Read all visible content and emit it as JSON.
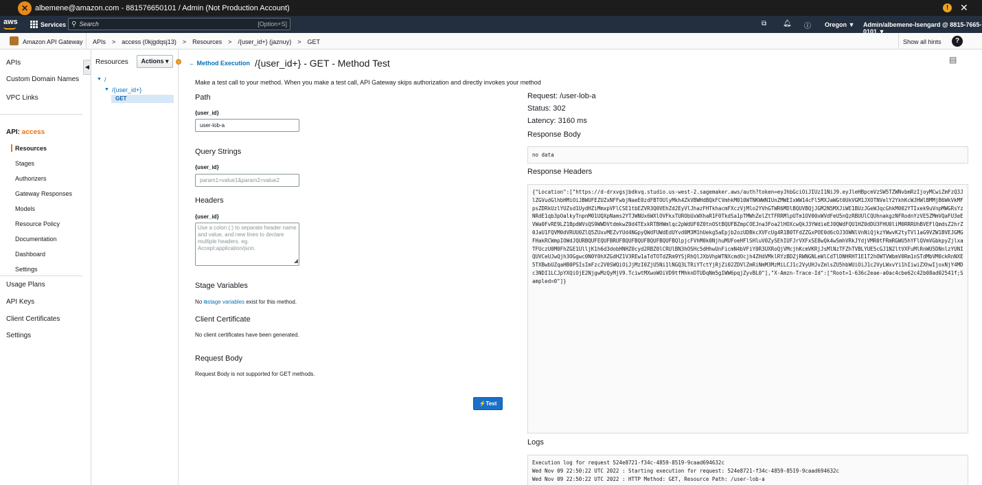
{
  "account_bar": {
    "text": "albemene@amazon.com - 881576650101 / Admin (Not Production Account)",
    "logo_icon": "account-logo",
    "warn_icon": "!",
    "close_icon": "✕"
  },
  "aws_nav": {
    "logo": "aws",
    "services_label": "Services",
    "search_placeholder": "Search",
    "search_shortcut": "[Option+S]",
    "region": "Oregon ▼",
    "user": "Admin/albemene-Isengard @ 8815-7665-0101 ▼"
  },
  "service_bar": {
    "service_name": "Amazon API Gateway",
    "breadcrumbs": [
      "APIs",
      ">",
      "access (0kjgdqsj13)",
      ">",
      "Resources",
      ">",
      "/{user_id+} (jaznuy)",
      ">",
      "GET"
    ],
    "show_hints": "Show all hints",
    "help": "?"
  },
  "left_nav": {
    "apis": "APIs",
    "custom_domains": "Custom Domain Names",
    "vpc_links": "VPC Links",
    "api_prefix": "API:",
    "api_name": "access",
    "sub_items": [
      "Resources",
      "Stages",
      "Authorizers",
      "Gateway Responses",
      "Models",
      "Resource Policy",
      "Documentation",
      "Dashboard",
      "Settings"
    ],
    "usage_plans": "Usage Plans",
    "api_keys": "API Keys",
    "client_certs": "Client Certificates",
    "settings": "Settings",
    "collapse": "◀"
  },
  "resources": {
    "title": "Resources",
    "actions": "Actions ▾",
    "root": "/",
    "child": "/{user_id+}",
    "method": "GET"
  },
  "main": {
    "back_link": "Method Execution",
    "title": "/{user_id+} - GET - Method Test",
    "intro": "Make a test call to your method. When you make a test call, API Gateway skips authorization and directly invokes your method",
    "path_heading": "Path",
    "path_label": "{user_id}",
    "path_value": "user-lob-a",
    "query_heading": "Query Strings",
    "query_label": "{user_id}",
    "query_placeholder": "param1=value1&param2=value2",
    "headers_heading": "Headers",
    "headers_label": "{user_id}",
    "headers_placeholder": "Use a colon (:) to separate header name and value, and new lines to declare multiple headers. eg. Accept:application/json.",
    "stage_vars_heading": "Stage Variables",
    "stage_vars_pre": "No",
    "stage_vars_link": "stage variables",
    "stage_vars_post": "exist for this method.",
    "client_cert_heading": "Client Certificate",
    "client_cert_text": "No client certificates have been generated.",
    "request_body_heading": "Request Body",
    "request_body_text": "Request Body is not supported for GET methods.",
    "test_button": "Test"
  },
  "response": {
    "request": "Request: /user-lob-a",
    "status": "Status: 302",
    "latency": "Latency: 3160 ms",
    "body_heading": "Response Body",
    "body": "no data",
    "headers_heading": "Response Headers",
    "headers": "{\"Location\":[\"https://d-drxvgsjbdkvq.studio.us-west-2.sagemaker.aws/auth?token=eyJhbGciOiJIUzI1NiJ9.eyJleHBpcmVzSW5TZWNvbmRzIjoyMCwiZmFzQ3JlZGVudGlhbHMiOiJBWUFEZUZxNFFwbjNaeE0zdFBTOUlyMkh4ZkVBWHdBQkFCVmhkM010WTNKWWNIUnZMWEIxWW14cFl5MXJaWGt0UkVGM1JXOTNVelY2YkhKcWJHWlBMMjB6WkVkMFpsZDRkUzlYUZsd1UydHZiMmxpVFlCSE1tbEZVR3Q0VEhZd2EyVlJhazFHTkhacmFXczVjMlo2YVhGTWR6MDlBQUVBQjJGM2N5MXJiWE1BUzJGeWJqcGhkM002YTIxek9uVnpMWGRsYzNRdE1qb3pOalkyTnpnM01UQXpNams2YTJWNUx6WXlOVFkxTURObUxWXhaR1F0TkdSa1pTMWhZelZtTFRRMlpUTm1OV00xWVdFeU5nQzRBUUlCQUhnakgzNFRodnYzVE5ZMmVQaFU3eEVWa0FvRE9LZ1BpdWVsQS9WWDVtdmkwZ0d4TExkRTBHWmlqc2pWdUF0Z0tnOStBQUFBZmpCOEJna3Foa2lHOXcwQkJ3YWdieEJ0QWdFQU1HZ0dDU3FHU0liM0RRRUhBVEFlQmdsZ2hrZ0JaU1FQVM0dVRUU0ZlQ5ZUxvMEZvYUd4NGpyQWdFUWdEdUYvd0M3M1hUekg5aEpjb2ozUDBkcXVFcUg4R1B0TFdZZGxPOE0d6cOJ3OWNlVnNiQjkzYWwvK2tyTVl1aG9VZW1BVEJGMGFHakRCWmpIOWdJQURBQUFEQUFBRUFBQUFBQUFBQUFBQUFBQlpjcFVhM0k0NjhuMUFoeHFlSHluV0ZySEhIUFJrVXFxSE8wQk4wSmhVRkJYdjVMR0tFRmRGWU5hYFlQVmVGbkpyZjlxaTFUczU0M0FhZGE1UlljK1h6d3dobHNHZ0cyd2RBZ0lCRUlBN3hOSHc5dHhwUnFicmN4bVFiY0R3UXRoQjVMcjhKcmVKRjJsMlNzTFZhTVBLYUE5cGJ1N2ltVXFuMlRnWU5DNnlzYUNIQUVCeUJwQjh3OGgwc0N0Y0hXZGdHZ1V3REw1aTdTOTdZRm9YSjRhQlJXbVhpWTNXcmdOcjh4ZHdVMklRYzBDZjRWNGNLeWlCdTlDNHRHT1E1T2hOWTVWbmV0Rm1nSTdMbVM0ckRnNXE5TXBwbUZqaHB0PSIsImFzc2V0SWQiOiJjMzI0ZjU5Ni1lNGQ3LTRiYTctYjRjZi02ZDVlZmRiNmM3MzMiLCJ1c2VyUHJvZmlsZU5hbWUiOiJ1c2VyLWxvYi1hIiwiZXhwIjoxNjY4MDc3NDI1LCJpYXQiOjE2NjgwMzQyMjV9.TciwtMXwoWOiVD9tfMhknDTUDqNm5gIWW6pqjZyvBL0\"],\"X-Amzn-Trace-Id\":[\"Root=1-636c2eae-a0ac4cbe62c42b08ad02541f;Sampled=0\"]}",
    "logs_heading": "Logs",
    "logs": "Execution log for request 524e8721-f34c-4859-8519-9caad694632c\nWed Nov 09 22:50:22 UTC 2022 : Starting execution for request: 524e8721-f34c-4859-8519-9caad694632c\nWed Nov 09 22:50:22 UTC 2022 : HTTP Method: GET, Resource Path: /user-lob-a"
  }
}
